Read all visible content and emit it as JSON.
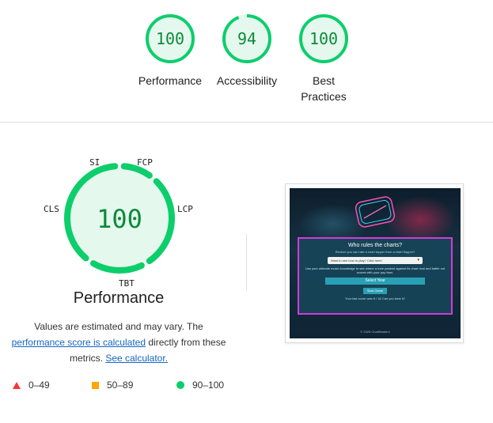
{
  "categories": [
    {
      "score": "100",
      "label": "Performance",
      "value": 100
    },
    {
      "score": "94",
      "label": "Accessibility",
      "value": 94
    },
    {
      "score": "100",
      "label_line1": "Best",
      "label_line2": "Practices",
      "value": 100
    }
  ],
  "performance": {
    "score": "100",
    "title": "Performance",
    "metrics": {
      "si": "SI",
      "fcp": "FCP",
      "lcp": "LCP",
      "tbt": "TBT",
      "cls": "CLS"
    }
  },
  "description": {
    "text1": "Values are estimated and may vary. The",
    "link1": "performance score is calculated",
    "text2": "directly from these metrics.",
    "link2": "See calculator."
  },
  "legend": {
    "fail": "0–49",
    "average": "50–89",
    "pass": "90–100"
  },
  "colors": {
    "pass": "#0cce6b",
    "pass_text": "#0c8a3a",
    "pass_bg": "#e5f8ee",
    "average": "#ffa400",
    "fail": "#ff3333"
  },
  "screenshot": {
    "heading": "Who rules the charts?",
    "subheading": "Reckon you can rate a chart topper from a chart flopper?",
    "select_value": "Want to see how to play? Click here!",
    "body": "Use your ultimate music knowledge to see where a tune peaked against its chart rival and battle out scores with your pop foes.",
    "select_button": "Select Year",
    "start_button": "Start Game",
    "last_score": "Your last score was 6 / 16 Can you beat it?",
    "footer": "© 2025 ChartBusters"
  }
}
